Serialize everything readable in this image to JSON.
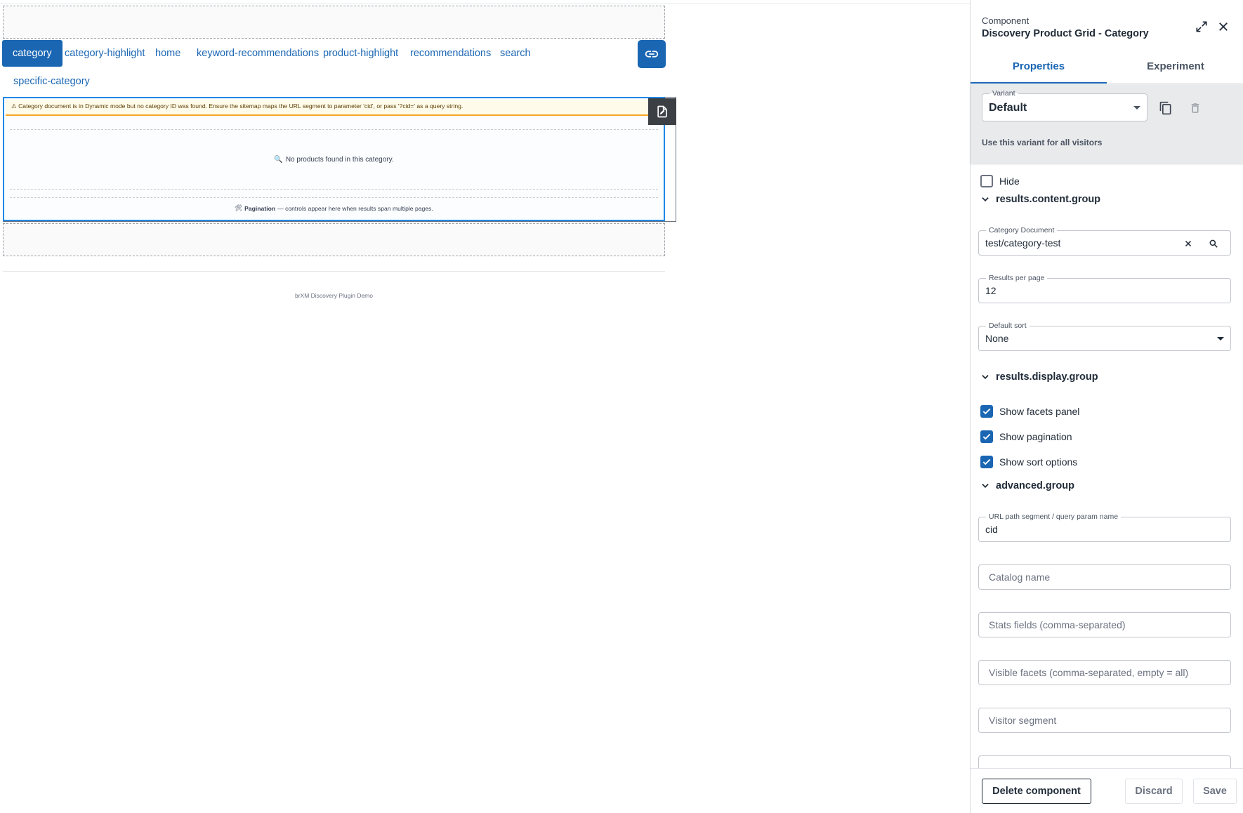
{
  "preview": {
    "nav": {
      "links": [
        "category",
        "category-highlight",
        "home",
        "keyword-recommendations",
        "product-highlight",
        "recommendations",
        "search",
        "specific-category"
      ],
      "active": "category"
    },
    "warning": "⚠ Category document is in Dynamic mode but no category ID was found. Ensure the sitemap maps the URL segment to parameter 'cid', or pass '?cid=' as a query string.",
    "empty_icon": "🔍",
    "empty_text": "No products found in this category.",
    "pagination_icon": "🛠",
    "pagination_label": "Pagination",
    "pagination_text": "— controls appear here when results span multiple pages.",
    "footer": "brXM Discovery Plugin Demo"
  },
  "panel": {
    "label": "Component",
    "title": "Discovery Product Grid - Category",
    "tabs": [
      "Properties",
      "Experiment"
    ],
    "active_tab": "Properties",
    "variant": {
      "legend": "Variant",
      "value": "Default",
      "hint": "Use this variant for all visitors"
    },
    "hide_label": "Hide",
    "hide_checked": false,
    "groups": {
      "content": "results.content.group",
      "display": "results.display.group",
      "advanced": "advanced.group"
    },
    "fields": {
      "category_document": {
        "legend": "Category Document",
        "value": "test/category-test"
      },
      "results_per_page": {
        "legend": "Results per page",
        "value": "12"
      },
      "default_sort": {
        "legend": "Default sort",
        "value": "None"
      },
      "url_segment": {
        "legend": "URL path segment / query param name",
        "value": "cid"
      },
      "catalog_name": {
        "placeholder": "Catalog name"
      },
      "stats_fields": {
        "placeholder": "Stats fields (comma-separated)"
      },
      "visible_facets": {
        "placeholder": "Visible facets (comma-separated, empty = all)"
      },
      "visitor_segment": {
        "placeholder": "Visitor segment"
      }
    },
    "checkboxes": [
      {
        "label": "Show facets panel",
        "checked": true
      },
      {
        "label": "Show pagination",
        "checked": true
      },
      {
        "label": "Show sort options",
        "checked": true
      }
    ],
    "buttons": {
      "delete": "Delete component",
      "discard": "Discard",
      "save": "Save"
    }
  },
  "colors": {
    "primary": "#1a66b3",
    "selection": "#1e88e5",
    "warning_border": "#f5a623",
    "warning_bg": "#fffbea"
  }
}
